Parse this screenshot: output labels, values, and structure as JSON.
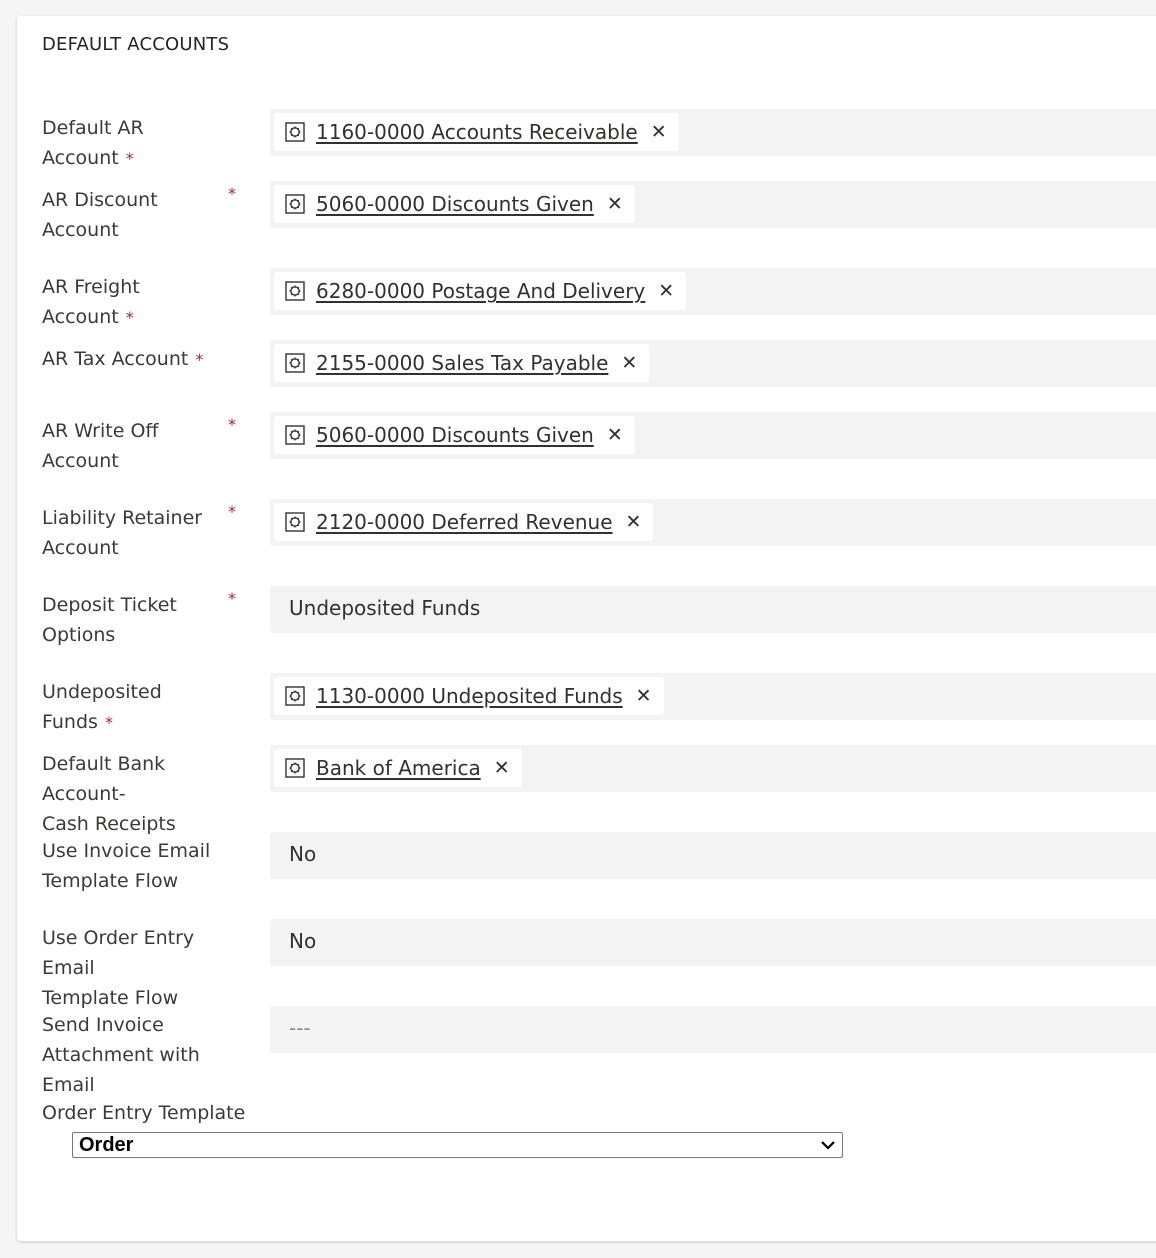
{
  "section": {
    "title": "DEFAULT ACCOUNTS"
  },
  "fields": [
    {
      "label_lines": [
        "Default AR Account"
      ],
      "required": true,
      "value": "1160-0000 Accounts Receivable",
      "kind": "lookup"
    },
    {
      "label_lines": [
        "AR Discount",
        "Account"
      ],
      "required": true,
      "value": "5060-0000 Discounts Given",
      "kind": "lookup"
    },
    {
      "label_lines": [
        "AR Freight Account"
      ],
      "required": true,
      "value": "6280-0000 Postage And Delivery",
      "kind": "lookup"
    },
    {
      "label_lines": [
        "AR Tax Account"
      ],
      "required": true,
      "value": "2155-0000 Sales Tax Payable",
      "kind": "lookup"
    },
    {
      "label_lines": [
        "AR Write Off",
        "Account"
      ],
      "required": true,
      "value": "5060-0000 Discounts Given",
      "kind": "lookup"
    },
    {
      "label_lines": [
        "Liability Retainer",
        "Account"
      ],
      "required": true,
      "value": "2120-0000 Deferred Revenue",
      "kind": "lookup"
    },
    {
      "label_lines": [
        "Deposit Ticket",
        "Options"
      ],
      "required": true,
      "value": "Undeposited Funds",
      "kind": "text"
    },
    {
      "label_lines": [
        "Undeposited Funds"
      ],
      "required": true,
      "value": "1130-0000 Undeposited Funds",
      "kind": "lookup"
    },
    {
      "label_lines": [
        "Default Bank Account-",
        "Cash Receipts"
      ],
      "required": false,
      "value": "Bank of America",
      "kind": "lookup"
    },
    {
      "label_lines": [
        "Use Invoice Email",
        "Template Flow"
      ],
      "required": false,
      "value": "No",
      "kind": "text"
    },
    {
      "label_lines": [
        "Use Order Entry Email",
        "Template Flow"
      ],
      "required": false,
      "value": "No",
      "kind": "text"
    },
    {
      "label_lines": [
        "Send Invoice",
        "Attachment with Email"
      ],
      "required": false,
      "value": "---",
      "kind": "empty"
    }
  ],
  "required_marker": "*",
  "close_glyph": "✕",
  "order_entry": {
    "label": "Order Entry Template",
    "selected": "Order"
  },
  "colors": {
    "required": "#a4262c",
    "field_bg": "#f3f3f3",
    "card_bg": "#ffffff"
  }
}
